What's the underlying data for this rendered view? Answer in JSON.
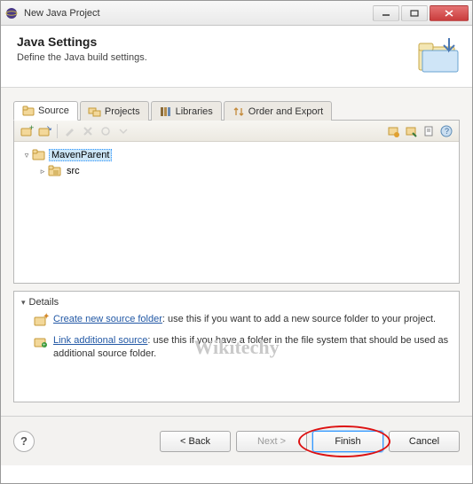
{
  "window": {
    "title": "New Java Project"
  },
  "header": {
    "title": "Java Settings",
    "subtitle": "Define the Java build settings."
  },
  "tabs": [
    {
      "label": "Source",
      "icon": "source-folder-icon",
      "active": true
    },
    {
      "label": "Projects",
      "icon": "projects-icon",
      "active": false
    },
    {
      "label": "Libraries",
      "icon": "libraries-icon",
      "active": false
    },
    {
      "label": "Order and Export",
      "icon": "order-export-icon",
      "active": false
    }
  ],
  "tree": {
    "root": {
      "label": "MavenParent",
      "expanded": true,
      "selected": true
    },
    "children": [
      {
        "label": "src",
        "expanded": false
      }
    ]
  },
  "details": {
    "header": "Details",
    "items": [
      {
        "link": "Create new source folder",
        "text": ": use this if you want to add a new source folder to your project."
      },
      {
        "link": "Link additional source",
        "text": ": use this if you have a folder in the file system that should be used as additional source folder."
      }
    ]
  },
  "buttons": {
    "back": "< Back",
    "next": "Next >",
    "finish": "Finish",
    "cancel": "Cancel"
  },
  "watermark": "Wikitechy",
  "colors": {
    "link": "#2258a5",
    "selection": "#cde6f7",
    "accent": "#3399ff",
    "highlight_ring": "#d11"
  }
}
